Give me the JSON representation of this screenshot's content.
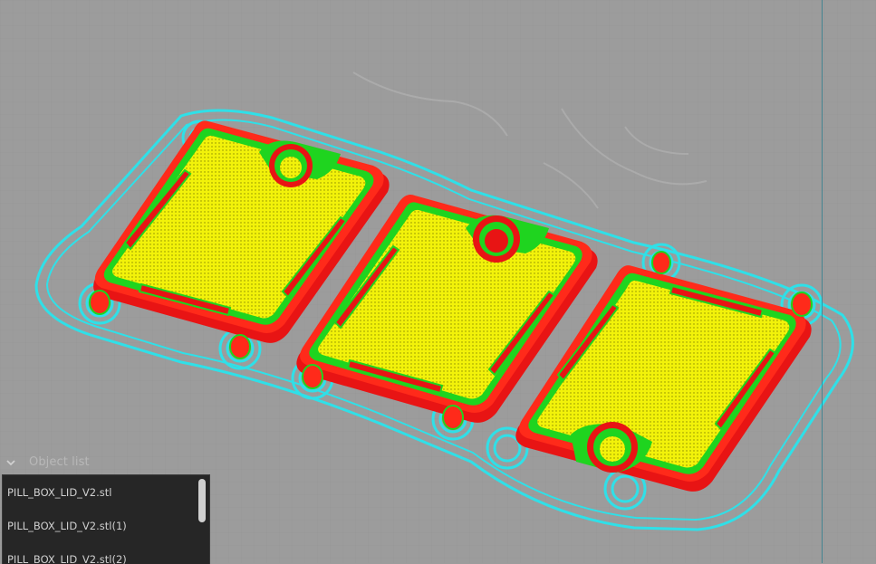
{
  "object_list": {
    "title": "Object list",
    "items": [
      {
        "label": "PILL_BOX_LID_V2.stl"
      },
      {
        "label": "PILL_BOX_LID_V2.stl(1)"
      },
      {
        "label": "PILL_BOX_LID_V2.stl(2)"
      }
    ]
  },
  "colors": {
    "background": "#9c9c9c",
    "perimeter": "#ff1a1a",
    "inner_perimeter": "#1fd41f",
    "top_infill": "#f2f20a",
    "skirt_brim": "#2fe0e8",
    "panel_bg": "#262626"
  },
  "icons": [
    "chevron-down-icon"
  ]
}
